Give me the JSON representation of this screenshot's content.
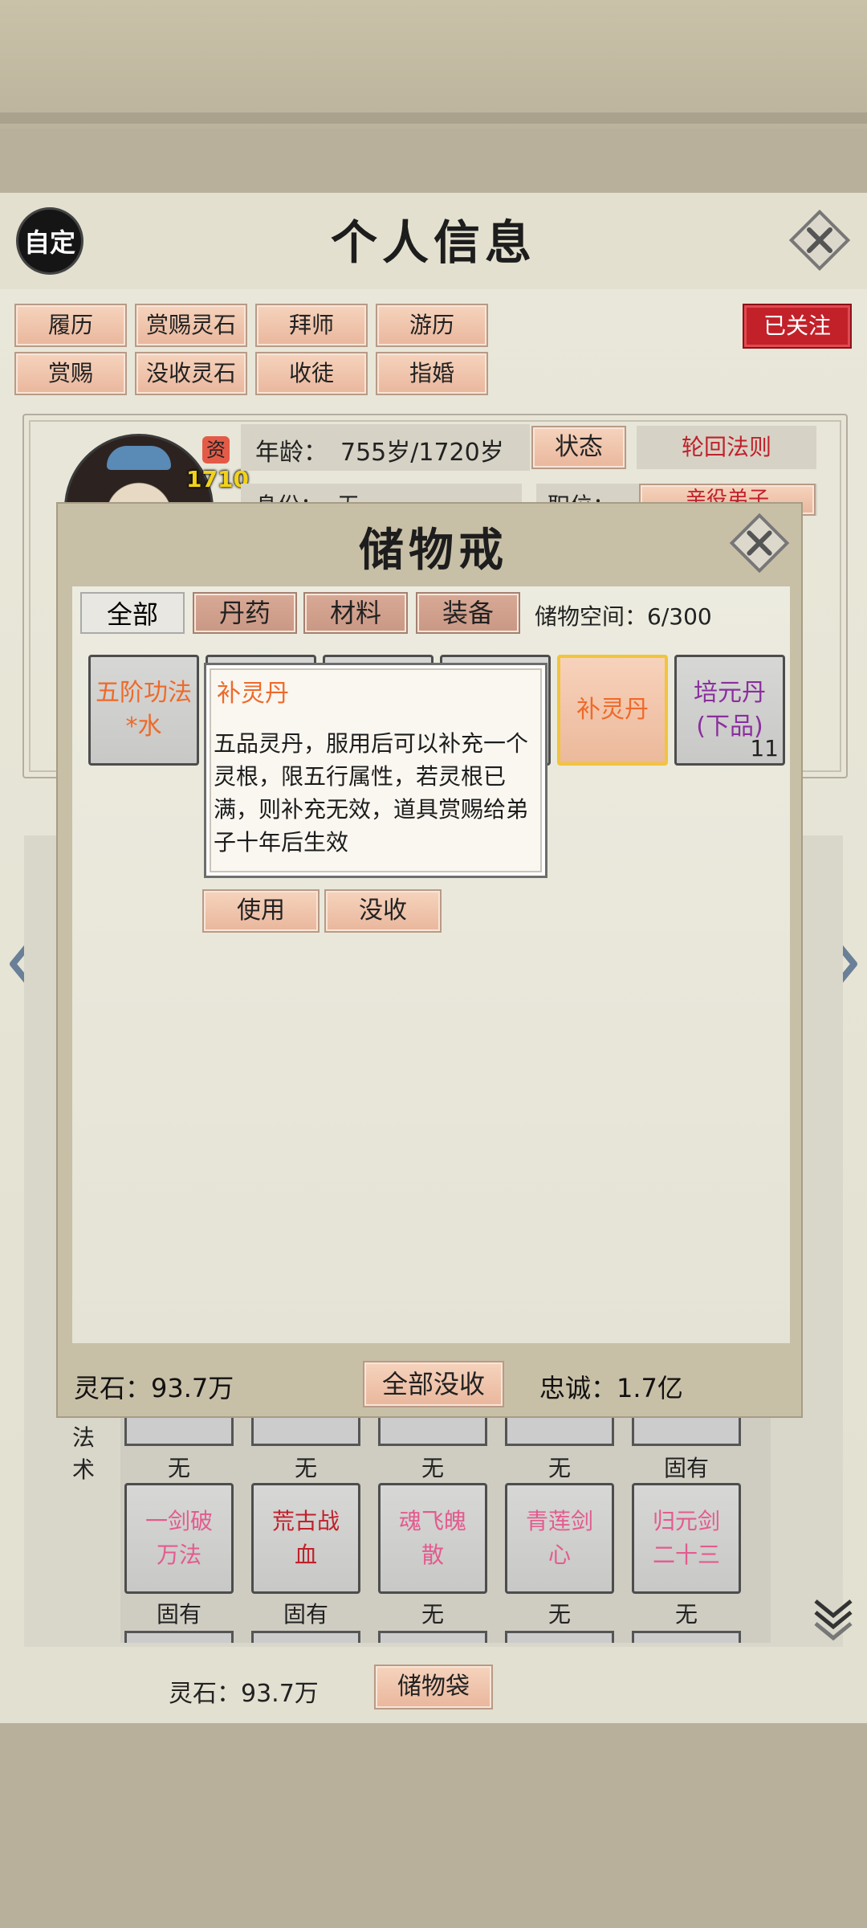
{
  "header": {
    "auto_label": "自定",
    "title": "个人信息"
  },
  "top_buttons": [
    {
      "label": "履历"
    },
    {
      "label": "赏赐灵石"
    },
    {
      "label": "拜师"
    },
    {
      "label": "游历"
    },
    {
      "label": "赏赐"
    },
    {
      "label": "没收灵石"
    },
    {
      "label": "收徒"
    },
    {
      "label": "指婚"
    }
  ],
  "follow_badge": "已关注",
  "profile": {
    "aptitude_label": "资",
    "aptitude_value": "1710",
    "age_label": "年龄：",
    "age_value": "755岁/1720岁",
    "status_button": "状态",
    "reincarnation_button": "轮回法则",
    "identity_label": "身份：",
    "identity_value": "无",
    "position_label": "职位：",
    "position_value": "亲役弟子"
  },
  "spells": {
    "section_label": "法术",
    "row1_tags": [
      "无",
      "无",
      "无",
      "无",
      "固有"
    ],
    "row2": [
      {
        "name": "一剑破万法",
        "color": "#e35b8f"
      },
      {
        "name": "荒古战血",
        "color": "#c0212b"
      },
      {
        "name": "魂飞魄散",
        "color": "#e35b8f"
      },
      {
        "name": "青莲剑心",
        "color": "#e35b8f"
      },
      {
        "name": "归元剑二十三",
        "color": "#e35b8f"
      }
    ],
    "row2_tags": [
      "固有",
      "固有",
      "无",
      "无",
      "无"
    ]
  },
  "footer": {
    "spirit_stone": "灵石：93.7万",
    "bag_button": "储物袋"
  },
  "storage": {
    "title": "储物戒",
    "tabs": [
      {
        "label": "全部"
      },
      {
        "label": "丹药"
      },
      {
        "label": "材料"
      },
      {
        "label": "装备"
      }
    ],
    "capacity": "储物空间：6/300",
    "items": [
      {
        "name": "五阶功法*水",
        "color": "#ee6a2a",
        "count": ""
      },
      {
        "name": "补灵丹",
        "color": "#ee6a2a",
        "count": ""
      },
      {
        "name": "培元丹(下品)",
        "color": "#8a2e9e",
        "count": "11"
      }
    ],
    "tooltip": {
      "name": "补灵丹",
      "desc": "五品灵丹，服用后可以补充一个灵根，限五行属性，若灵根已满，则补充无效，道具赏赐给弟子十年后生效"
    },
    "use_button": "使用",
    "confiscate_button": "没收",
    "bottom": {
      "spirit_stone": "灵石：93.7万",
      "confiscate_all": "全部没收",
      "loyalty": "忠诚：1.7亿"
    }
  },
  "colors": {
    "accent_red": "#c0212b",
    "item_orange": "#ee6a2a",
    "item_purple": "#8a2e9e"
  }
}
